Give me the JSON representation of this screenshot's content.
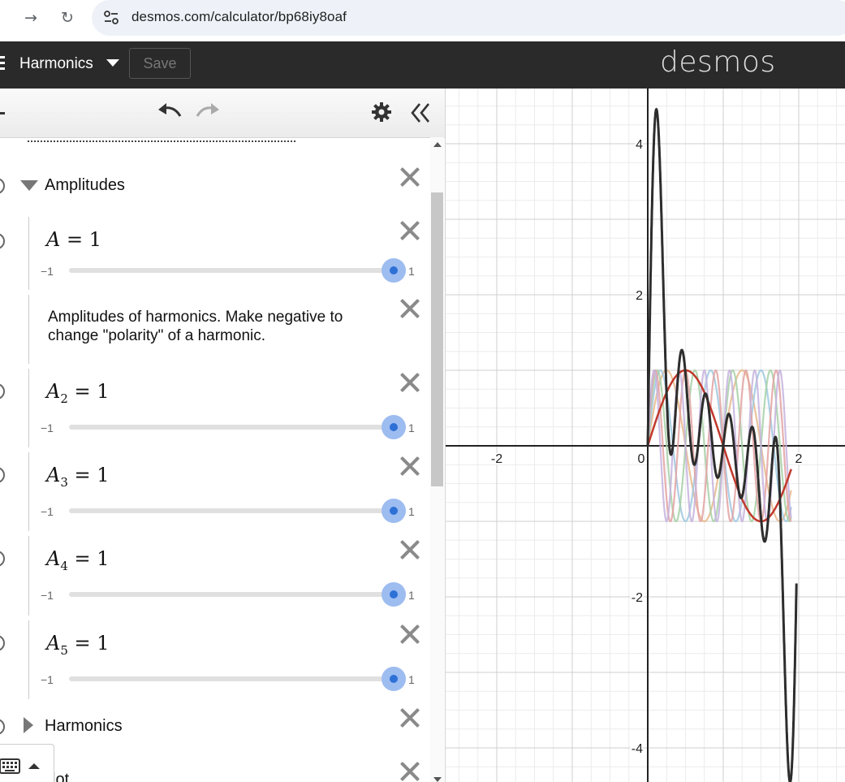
{
  "browser": {
    "url": "desmos.com/calculator/bp68iy8oaf",
    "forward_icon": "arrow-right",
    "reload_icon": "reload"
  },
  "header": {
    "graph_title": "Harmonics",
    "save_label": "Save",
    "logo": "desmos"
  },
  "toolbar": {
    "undo_icon": "undo",
    "redo_icon": "redo",
    "settings_icon": "gear",
    "collapse_icon": "double-chevron-left"
  },
  "expressions": {
    "folder_amplitudes": "Amplitudes",
    "slider_a": {
      "name": "A",
      "sub": "",
      "eq": " = 1",
      "min": "−1",
      "max": "1",
      "value": 1
    },
    "note": "Amplitudes of harmonics. Make negative to change \"polarity\" of a harmonic.",
    "slider_a2": {
      "name": "A",
      "sub": "2",
      "eq": " = 1",
      "min": "−1",
      "max": "1",
      "value": 1
    },
    "slider_a3": {
      "name": "A",
      "sub": "3",
      "eq": " = 1",
      "min": "−1",
      "max": "1",
      "value": 1
    },
    "slider_a4": {
      "name": "A",
      "sub": "4",
      "eq": " = 1",
      "min": "−1",
      "max": "1",
      "value": 1
    },
    "slider_a5": {
      "name": "A",
      "sub": "5",
      "eq": " = 1",
      "min": "−1",
      "max": "1",
      "value": 1
    },
    "folder_harmonics": "Harmonics",
    "partial_bottom": "lot"
  },
  "graph": {
    "x_ticks": [
      "-2",
      "0",
      "2"
    ],
    "y_ticks": [
      "4",
      "2",
      "-2",
      "-4"
    ],
    "colors": {
      "sum": "#2d2d2d",
      "fundamental": "#c0392b",
      "harmonic_light": [
        "#e8b98a",
        "#9fc8e0",
        "#a6d0a6",
        "#e3a2a2",
        "#c6b3de"
      ]
    }
  }
}
